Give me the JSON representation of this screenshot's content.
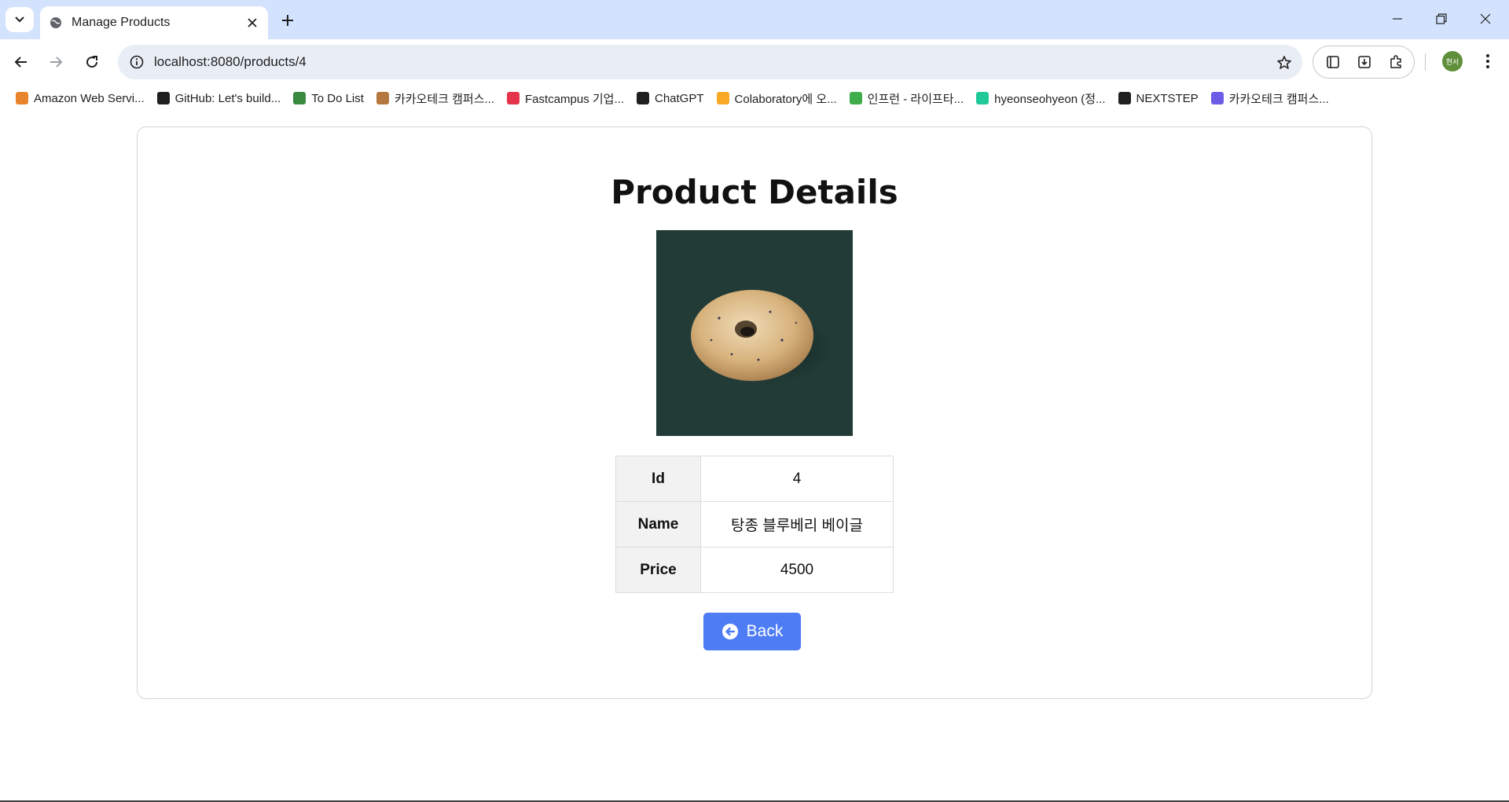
{
  "browser": {
    "tab_title": "Manage Products",
    "url": "localhost:8080/products/4",
    "avatar_text": "현서",
    "bookmarks": [
      {
        "label": "Amazon Web Servi...",
        "icon": "aws-cube-icon",
        "color": "#e8852c"
      },
      {
        "label": "GitHub: Let's build...",
        "icon": "github-icon",
        "color": "#1f1f1f"
      },
      {
        "label": "To Do List",
        "icon": "leaf-icon",
        "color": "#3a8a3f"
      },
      {
        "label": "카카오테크 캠퍼스...",
        "icon": "cookie-icon",
        "color": "#b4773f"
      },
      {
        "label": "Fastcampus 기업...",
        "icon": "fastcampus-icon",
        "color": "#e3344b"
      },
      {
        "label": "ChatGPT",
        "icon": "chatgpt-icon",
        "color": "#1f1f1f"
      },
      {
        "label": "Colaboratory에 오...",
        "icon": "colab-icon",
        "color": "#f9a825"
      },
      {
        "label": "인프런 - 라이프타...",
        "icon": "inflearn-icon",
        "color": "#3fae4a"
      },
      {
        "label": "hyeonseohyeon (정...",
        "icon": "velog-icon",
        "color": "#20c997"
      },
      {
        "label": "NEXTSTEP",
        "icon": "nextstep-icon",
        "color": "#1f1f1f"
      },
      {
        "label": "카카오테크 캠퍼스...",
        "icon": "kakao-campus-icon",
        "color": "#6c5ce7"
      }
    ]
  },
  "page": {
    "title": "Product Details",
    "image_alt_icon": "bagel-image",
    "rows": [
      {
        "label": "Id",
        "value": "4"
      },
      {
        "label": "Name",
        "value": "탕종 블루베리 베이글"
      },
      {
        "label": "Price",
        "value": "4500"
      }
    ],
    "back_label": "Back"
  },
  "colors": {
    "accent": "#4d7cf5",
    "image_bg": "#223b37",
    "tabstrip": "#d3e3fd"
  }
}
